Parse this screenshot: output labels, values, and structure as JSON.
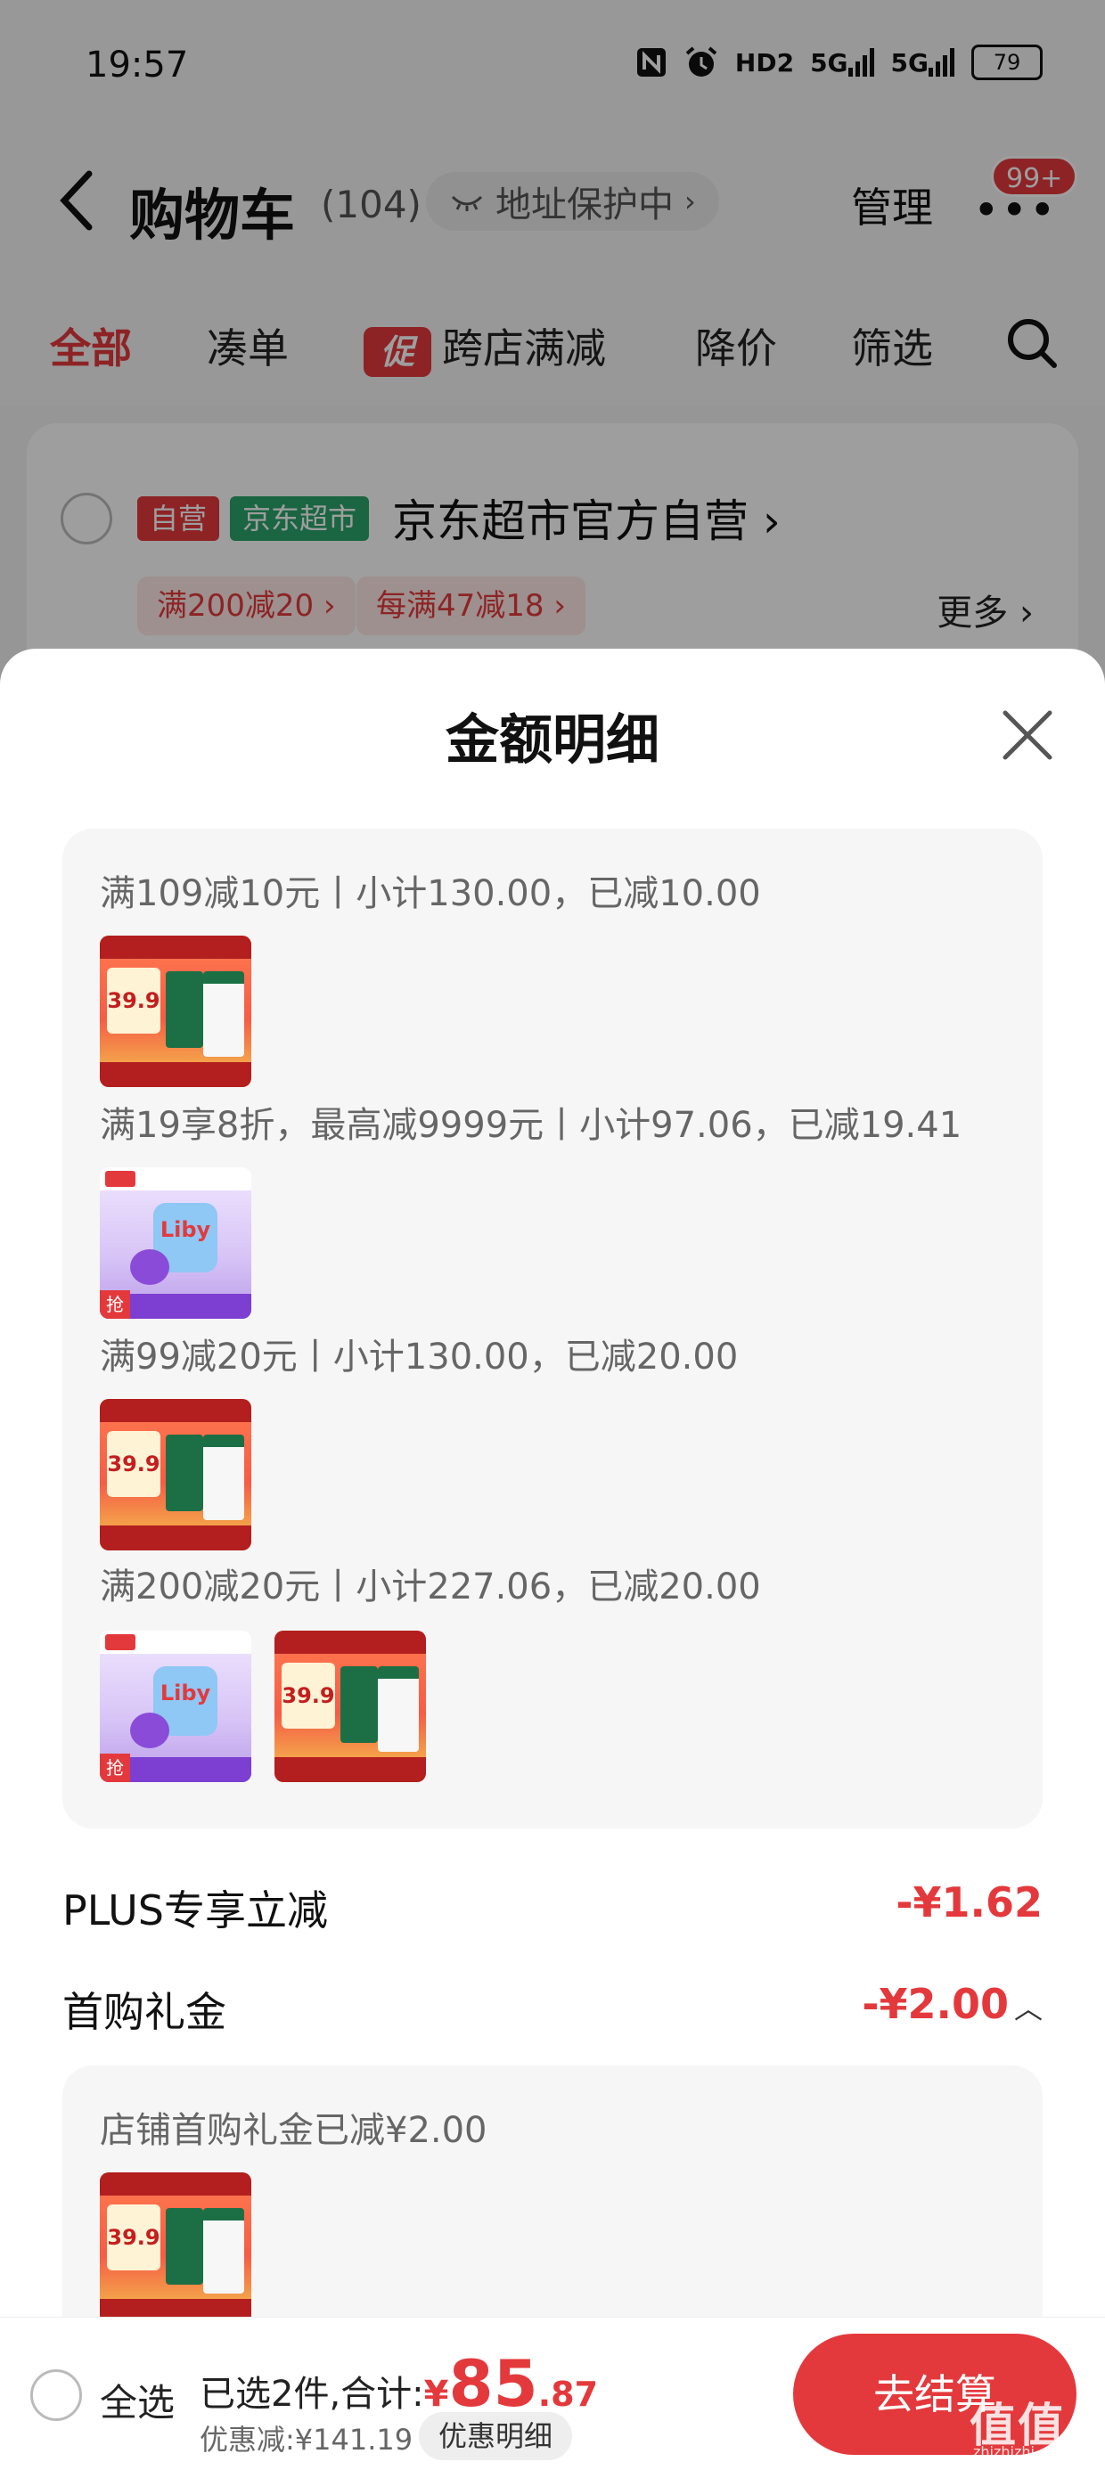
{
  "status_bar": {
    "time": "19:57",
    "icons": [
      "nfc-icon",
      "alarm-icon",
      "hd-icon",
      "signal-5g-icon",
      "signal-5g-icon",
      "battery-icon"
    ],
    "hd_label": "HD2",
    "net1": "5G",
    "net2": "5G",
    "battery": "79"
  },
  "header": {
    "title": "购物车",
    "count": "(104)",
    "address_protect": "地址保护中",
    "manage": "管理",
    "badge": "99+"
  },
  "tabs": [
    {
      "label": "全部",
      "active": true
    },
    {
      "label": "凑单"
    },
    {
      "label": "跨店满减",
      "tag": "促"
    },
    {
      "label": "降价"
    },
    {
      "label": "筛选"
    }
  ],
  "store": {
    "tag1": "自营",
    "tag2": "京东超市",
    "name": "京东超市官方自营",
    "coupons": [
      "满200减20",
      "每满47减18"
    ],
    "more": "更多"
  },
  "sheet": {
    "title": "金额明细",
    "promos": [
      {
        "text": "满109减10元丨小计130.00，已减10.00",
        "items": [
          "milk"
        ]
      },
      {
        "text": "满19享8折，最高减9999元丨小计97.06，已减19.41",
        "items": [
          "liby"
        ]
      },
      {
        "text": "满99减20元丨小计130.00，已减20.00",
        "items": [
          "milk"
        ]
      },
      {
        "text": "满200减20元丨小计227.06，已减20.00",
        "items": [
          "liby",
          "milk"
        ]
      }
    ],
    "plus_label": "PLUS专享立减",
    "plus_value": "-¥1.62",
    "gift_label": "首购礼金",
    "gift_value": "-¥2.00",
    "gift_detail": "店铺首购礼金已减¥2.00",
    "product_thumb_text": {
      "milk_price": "39.9",
      "liby_brand": "Liby",
      "liby_tag": "抢"
    }
  },
  "bottom_bar": {
    "select_all": "全选",
    "selected_text": "已选2件,合计:",
    "currency": "¥",
    "total_int": "85",
    "total_dec": ".87",
    "discount": "优惠减:¥141.19",
    "detail_button": "优惠明细",
    "checkout": "去结算"
  },
  "watermark": {
    "text": "值值值",
    "sub": "zhizhizhi.com"
  },
  "colors": {
    "accent": "#e4393c",
    "green_tag": "#2aa46b",
    "overlay": "rgba(0,0,0,0.38)"
  }
}
